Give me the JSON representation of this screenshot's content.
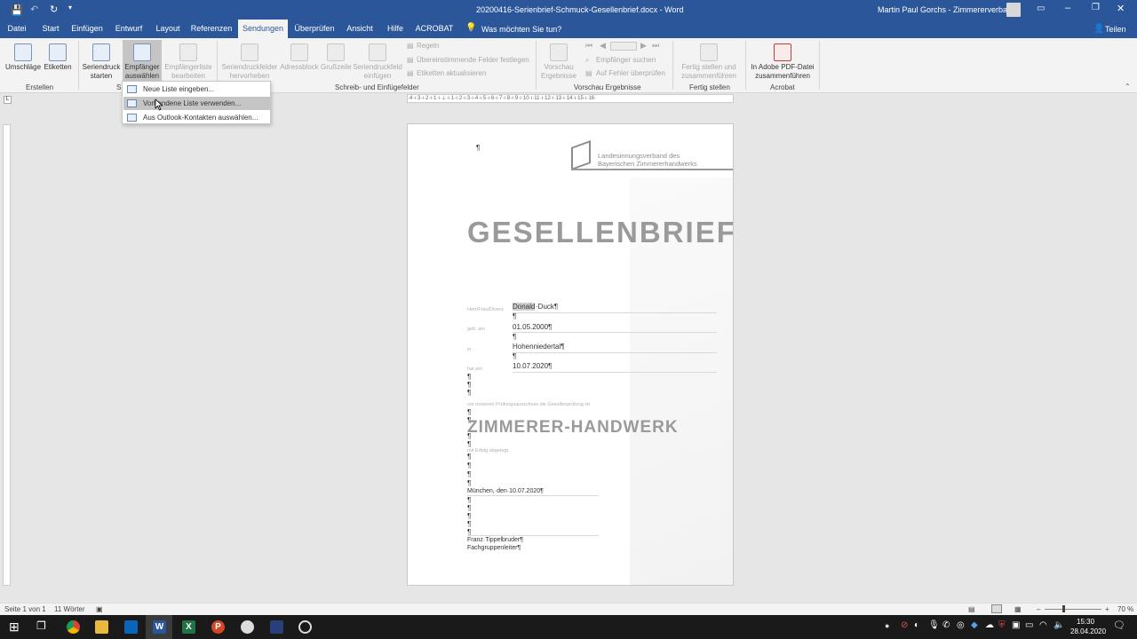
{
  "titlebar": {
    "document_title": "20200416-Serienbrief-Schmuck-Gesellenbrief.docx - Word",
    "user_name": "Martin Paul Gorchs - Zimmererverband"
  },
  "tabs": [
    "Datei",
    "Start",
    "Einfügen",
    "Entwurf",
    "Layout",
    "Referenzen",
    "Sendungen",
    "Überprüfen",
    "Ansicht",
    "Hilfe",
    "ACROBAT"
  ],
  "active_tab": "Sendungen",
  "tell_me": "Was möchten Sie tun?",
  "share_label": "Teilen",
  "ribbon": {
    "envelopes": "Umschläge",
    "labels": "Etiketten",
    "group_create": "Erstellen",
    "start_merge": [
      "Seriendruck",
      "starten"
    ],
    "select_recipients": [
      "Empfänger",
      "auswählen"
    ],
    "edit_list": [
      "Empfängerliste",
      "bearbeiten"
    ],
    "highlight_fields": [
      "Seriendruckfelder",
      "hervorheben"
    ],
    "address_block": "Adressblock",
    "greeting_line": "Grußzeile",
    "insert_field": [
      "Seriendruckfeld",
      "einfügen"
    ],
    "rules": "Regeln",
    "match_fields": "Übereinstimmende Felder festlegen",
    "update_labels": "Etiketten aktualisieren",
    "group_write": "Schreib- und Einfügefelder",
    "preview_results": [
      "Vorschau",
      "Ergebnisse"
    ],
    "find_recipient": "Empfänger suchen",
    "check_errors": "Auf Fehler überprüfen",
    "group_preview": "Vorschau Ergebnisse",
    "finish_merge": [
      "Fertig stellen und",
      "zusammenführen"
    ],
    "group_finish": "Fertig stellen",
    "acrobat_merge": [
      "In Adobe PDF-Datei",
      "zusammenführen"
    ],
    "group_acrobat": "Acrobat",
    "group_start_partial": "S"
  },
  "dropdown": {
    "items": [
      "Neue Liste eingeben...",
      "Vorhandene Liste verwenden...",
      "Aus Outlook-Kontakten auswählen..."
    ]
  },
  "ruler_text": "·4·ı·3·ı·2·ı·1·ı·⊥·ı·1·ı·2·ı·3·ı·4·ı·5·ı·6·ı·7·ı·8·ı·9·ı·10·ı·11·ı·12·ı·13·ı·14·ı·15·ı·16·",
  "document": {
    "logo_line1": "Landesinnungsverband des",
    "logo_line2": "Bayerischen Zimmererhandwerks",
    "heading": "GESELLENBRIEF",
    "label_salutation": "Herr/Frau/Divers",
    "first_name": "Donald",
    "last_name": "·Duck¶",
    "label_born": "geb. am",
    "birth_date": "01.05.2000¶",
    "label_in": "in",
    "birth_place": "Hohenniedertal¶",
    "label_passed": "hat am",
    "exam_date": "10.07.2020¶",
    "exam_text": "vor unserem Prüfungsausschuss die Gesellenprüfung im",
    "trade": "ZIMMERER-HANDWERK",
    "success_text": "mit Erfolg abgelegt.",
    "place_date": "München,·den·10.07.2020¶",
    "signer_name": "Franz·Tippelbruder¶",
    "signer_title": "Fachgruppenleiter¶",
    "pilcrow": "¶"
  },
  "statusbar": {
    "page": "Seite 1 von 1",
    "words": "11 Wörter",
    "zoom": "70 %"
  },
  "taskbar": {
    "time": "15:30",
    "date": "28.04.2020"
  },
  "colors": {
    "word_blue": "#2b579a",
    "ribbon_bg": "#f3f3f3",
    "doc_gray": "#9a9a9a"
  }
}
